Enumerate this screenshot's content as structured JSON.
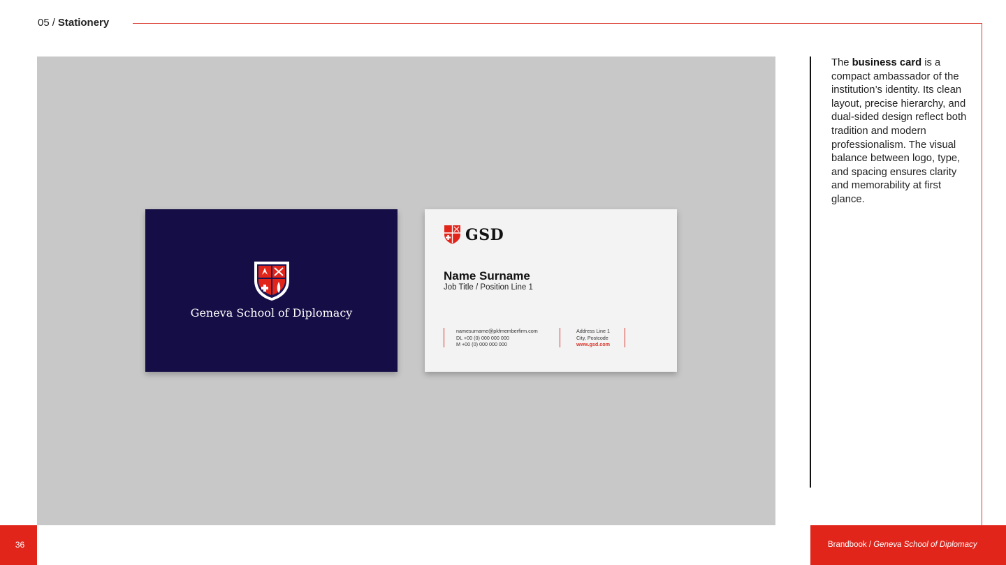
{
  "header": {
    "section_number": "05",
    "separator": "/",
    "section_title": "Stationery"
  },
  "card_front": {
    "institution_name": "Geneva School of Diplomacy",
    "background_color": "#150d45",
    "crest_icon": "shield-crest-icon"
  },
  "card_back": {
    "logo_text": "GSD",
    "name": "Name Surname",
    "job_title": "Job Title / Position Line 1",
    "email": "namesurname@pkfmemberfirm.com",
    "phone_dl": "DL  +00 (0) 000 000 000",
    "phone_m": "M   +00 (0) 000 000 000",
    "address_line_1": "Address Line 1",
    "address_line_2": "City, Postcode",
    "website": "www.gsd.com"
  },
  "description": {
    "part1": "The ",
    "bold": "business card",
    "part2": " is a compact ambassador of the institution’s identity. Its clean layout, precise hierarchy, and dual-sided design reflect both tradition and modern professionalism. The visual balance between logo, type, and spacing ensures clarity and memorability at first glance."
  },
  "footer": {
    "page_number": "36",
    "doc_label": "Brandbook / ",
    "doc_title": "Geneva School of Diplomacy"
  },
  "colors": {
    "accent_red": "#e1251b",
    "navy": "#150d45",
    "stage_gray": "#c8c8c8"
  }
}
